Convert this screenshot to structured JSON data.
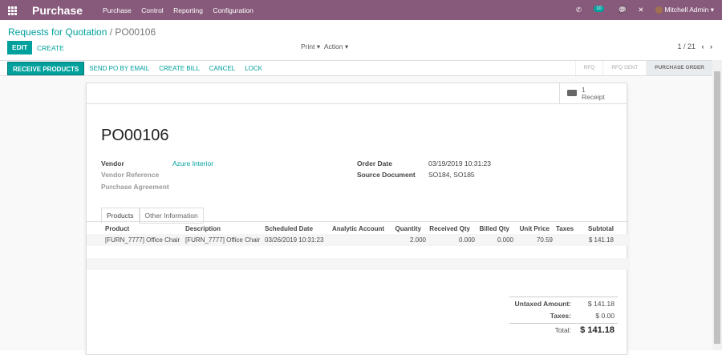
{
  "nav": {
    "app": "Purchase",
    "menu": [
      "Purchase",
      "Control",
      "Reporting",
      "Configuration"
    ],
    "activity_count": "10",
    "user": "Mitchell Admin"
  },
  "breadcrumb": {
    "parent": "Requests for Quotation",
    "current": "PO00106"
  },
  "toolbar": {
    "edit": "EDIT",
    "create": "CREATE",
    "print": "Print ▾",
    "action": "Action ▾",
    "pager": "1 / 21"
  },
  "statusbar": {
    "buttons": [
      "RECEIVE PRODUCTS",
      "SEND PO BY EMAIL",
      "CREATE BILL",
      "CANCEL",
      "LOCK"
    ],
    "steps": [
      "RFQ",
      "RFQ SENT",
      "PURCHASE ORDER"
    ]
  },
  "sheet": {
    "receipt_count": "1",
    "receipt_label": "Receipt",
    "name": "PO00106",
    "vendor_label": "Vendor",
    "vendor": "Azure Interior",
    "vendor_ref_label": "Vendor Reference",
    "agreement_label": "Purchase Agreement",
    "order_date_label": "Order Date",
    "order_date": "03/19/2019 10:31:23",
    "source_label": "Source Document",
    "source": "SO184, SO185",
    "tabs": [
      "Products",
      "Other Information"
    ],
    "columns": [
      "Product",
      "Description",
      "Scheduled Date",
      "Analytic Account",
      "Quantity",
      "Received Qty",
      "Billed Qty",
      "Unit Price",
      "Taxes",
      "Subtotal"
    ],
    "rows": [
      {
        "product": "[FURN_7777] Office Chair",
        "description": "[FURN_7777] Office Chair",
        "date": "03/26/2019 10:31:23",
        "analytic": "",
        "qty": "2.000",
        "received": "0.000",
        "billed": "0.000",
        "price": "70.59",
        "taxes": "",
        "subtotal": "$ 141.18"
      }
    ],
    "totals": {
      "untaxed_label": "Untaxed Amount:",
      "untaxed": "$ 141.18",
      "taxes_label": "Taxes:",
      "taxes": "$ 0.00",
      "total_label": "Total:",
      "total": "$ 141.18"
    }
  }
}
